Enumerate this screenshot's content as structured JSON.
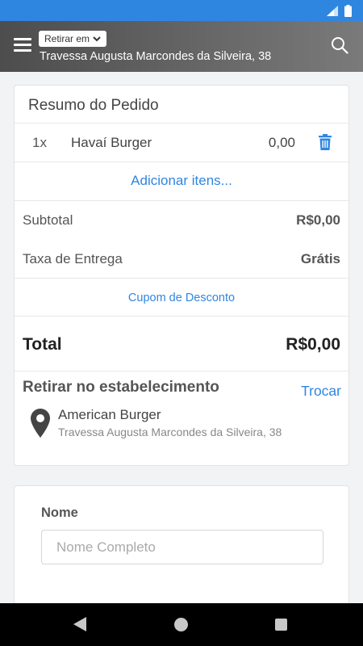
{
  "header": {
    "mode_label": "Retirar em",
    "address": "Travessa Augusta Marcondes da Silveira, 38"
  },
  "summary": {
    "title": "Resumo do Pedido",
    "items": [
      {
        "qty": "1x",
        "name": "Havaí Burger",
        "price": "0,00"
      }
    ],
    "add_items_label": "Adicionar itens...",
    "subtotal_label": "Subtotal",
    "subtotal_value": "R$0,00",
    "delivery_fee_label": "Taxa de Entrega",
    "delivery_fee_value": "Grátis",
    "coupon_label": "Cupom de Desconto",
    "total_label": "Total",
    "total_value": "R$0,00"
  },
  "pickup": {
    "title": "Retirar no estabelecimento",
    "change_label": "Trocar",
    "store_name": "American Burger",
    "store_address": "Travessa Augusta Marcondes da Silveira, 38"
  },
  "form": {
    "name_label": "Nome",
    "name_placeholder": "Nome Completo"
  },
  "colors": {
    "accent": "#2f86e0",
    "status_bar": "#2f86e0",
    "header_gradient_start": "#4d4d4d",
    "header_gradient_end": "#7a7a7a"
  },
  "icons": {
    "menu": "menu-icon",
    "search": "search-icon",
    "trash": "trash-icon",
    "pin": "location-pin-icon",
    "chevron": "chevron-down-icon"
  }
}
